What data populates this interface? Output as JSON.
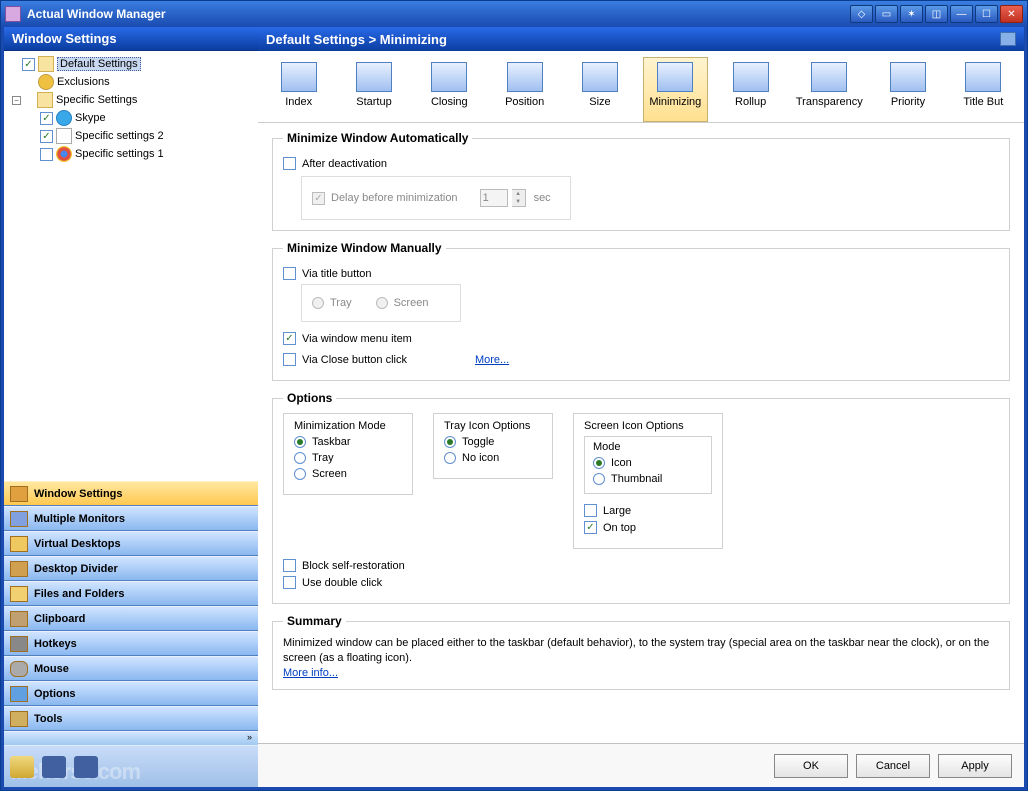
{
  "titlebar": {
    "title": "Actual Window Manager"
  },
  "sidebar": {
    "header": "Window Settings",
    "tree": {
      "default": "Default Settings",
      "exclusions": "Exclusions",
      "specific": "Specific Settings",
      "skype": "Skype",
      "s2": "Specific settings 2",
      "s1": "Specific settings 1"
    },
    "nav": [
      "Window Settings",
      "Multiple Monitors",
      "Virtual Desktops",
      "Desktop Divider",
      "Files and Folders",
      "Clipboard",
      "Hotkeys",
      "Mouse",
      "Options",
      "Tools"
    ]
  },
  "main": {
    "breadcrumb": "Default Settings > Minimizing",
    "toolbar": [
      "Index",
      "Startup",
      "Closing",
      "Position",
      "Size",
      "Minimizing",
      "Rollup",
      "Transparency",
      "Priority",
      "Title But"
    ],
    "selected_tab": "Minimizing"
  },
  "groups": {
    "auto": {
      "legend": "Minimize Window Automatically",
      "after": "After deactivation",
      "delay": "Delay before minimization",
      "delay_val": "1",
      "sec": "sec"
    },
    "manual": {
      "legend": "Minimize Window Manually",
      "via_title": "Via title button",
      "tray": "Tray",
      "screen": "Screen",
      "via_menu": "Via window menu item",
      "via_close": "Via Close button click",
      "more": "More..."
    },
    "options": {
      "legend": "Options",
      "mmode": "Minimization Mode",
      "taskbar": "Taskbar",
      "tray": "Tray",
      "screen": "Screen",
      "ticon": "Tray Icon Options",
      "toggle": "Toggle",
      "noicon": "No icon",
      "sicon": "Screen Icon Options",
      "mode": "Mode",
      "icon": "Icon",
      "thumb": "Thumbnail",
      "large": "Large",
      "ontop": "On top",
      "block": "Block self-restoration",
      "dbl": "Use double click"
    },
    "summary": {
      "legend": "Summary",
      "text": "Minimized window can be placed either to the taskbar (default behavior), to the system tray (special area on the taskbar near the clock), or on the screen (as a floating icon).",
      "more": "More info..."
    }
  },
  "footer": {
    "ok": "OK",
    "cancel": "Cancel",
    "apply": "Apply"
  }
}
